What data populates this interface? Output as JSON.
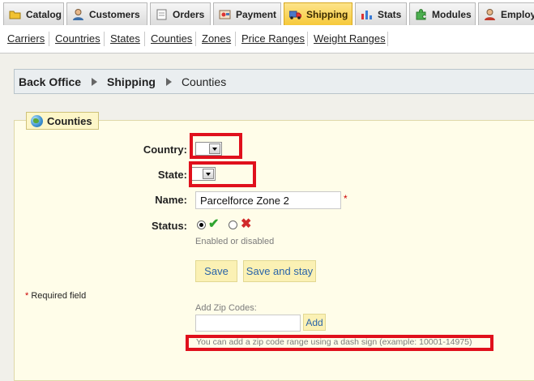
{
  "tabs": [
    {
      "label": "Catalog",
      "icon": "folder-icon"
    },
    {
      "label": "Customers",
      "icon": "customer-icon"
    },
    {
      "label": "Orders",
      "icon": "orders-icon"
    },
    {
      "label": "Payment",
      "icon": "payment-icon"
    },
    {
      "label": "Shipping",
      "icon": "truck-icon",
      "active": true
    },
    {
      "label": "Stats",
      "icon": "chart-icon"
    },
    {
      "label": "Modules",
      "icon": "puzzle-icon"
    },
    {
      "label": "Employees",
      "icon": "employee-icon"
    }
  ],
  "subnav": [
    "Carriers",
    "Countries",
    "States",
    "Counties",
    "Zones",
    "Price Ranges",
    "Weight Ranges"
  ],
  "breadcrumb": {
    "root": "Back Office",
    "section": "Shipping",
    "current": "Counties"
  },
  "fieldset": {
    "legend": "Counties"
  },
  "form": {
    "country_label": "Country:",
    "state_label": "State:",
    "name_label": "Name:",
    "name_value": "Parcelforce Zone 2",
    "required_mark": "*",
    "status_label": "Status:",
    "status_hint": "Enabled or disabled",
    "status_enabled": true,
    "save_label": "Save",
    "save_stay_label": "Save and stay",
    "required_note_mark": "*",
    "required_note": "Required field",
    "zip_label": "Add Zip Codes:",
    "zip_value": "",
    "zip_add_label": "Add",
    "zip_hint": "You can add a zip code range using a dash sign (example: 10001-14975)"
  },
  "colors": {
    "highlight_box": "#e0101c",
    "active_tab": "#f6c93a",
    "panel_bg": "#fffde9",
    "button_text": "#2a64a8"
  }
}
